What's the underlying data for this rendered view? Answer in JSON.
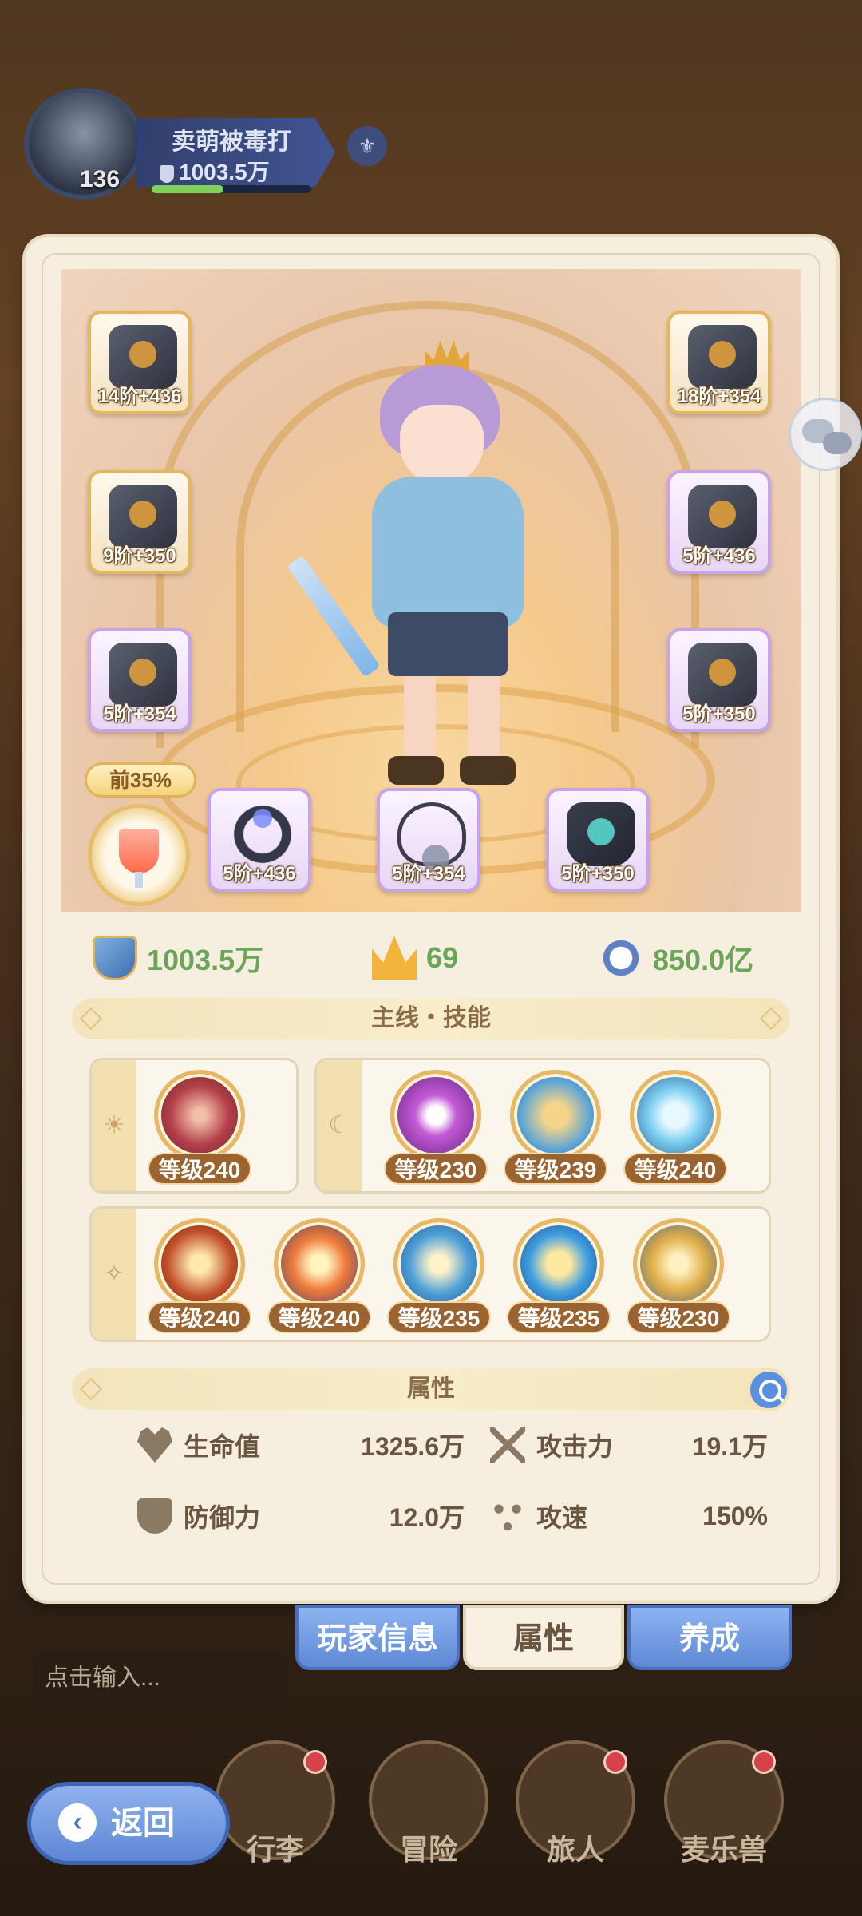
{
  "player": {
    "name": "卖萌被毒打",
    "power": "1003.5万",
    "level": "136"
  },
  "equipment": {
    "slots": [
      {
        "label": "14阶+436",
        "type": "weapon",
        "quality": "gold"
      },
      {
        "label": "18阶+354",
        "type": "helmet",
        "quality": "gold"
      },
      {
        "label": "9阶+350",
        "type": "armor",
        "quality": "gold"
      },
      {
        "label": "5阶+436",
        "type": "gauntlet",
        "quality": "purple"
      },
      {
        "label": "5阶+354",
        "type": "belt",
        "quality": "purple"
      },
      {
        "label": "5阶+350",
        "type": "boots",
        "quality": "purple"
      },
      {
        "label": "5阶+436",
        "type": "ring",
        "quality": "purple"
      },
      {
        "label": "5阶+354",
        "type": "necklace",
        "quality": "purple"
      },
      {
        "label": "5阶+350",
        "type": "bottle",
        "quality": "purple"
      }
    ],
    "drink_badge": "前35%"
  },
  "stats": {
    "power": "1003.5万",
    "crown": "69",
    "speed": "850.0亿"
  },
  "skills": {
    "header": "主线・技能",
    "group1": [
      "等级240"
    ],
    "group2": [
      "等级230",
      "等级239",
      "等级240"
    ],
    "group3": [
      "等级240",
      "等级240",
      "等级235",
      "等级235",
      "等级230"
    ]
  },
  "attributes": {
    "header": "属性",
    "hp_label": "生命值",
    "hp_value": "1325.6万",
    "atk_label": "攻击力",
    "atk_value": "19.1万",
    "def_label": "防御力",
    "def_value": "12.0万",
    "spd_label": "攻速",
    "spd_value": "150%"
  },
  "tabs": {
    "player_info": "玩家信息",
    "attributes": "属性",
    "training": "养成"
  },
  "chat": {
    "placeholder": "点击输入..."
  },
  "nav": {
    "back": "返回",
    "luggage": "行李",
    "adventure": "冒险",
    "traveler": "旅人",
    "pet": "麦乐兽"
  },
  "colors": {
    "accent_blue": "#5f88d6",
    "stat_green": "#6aa55a",
    "level_brown": "#9a6330"
  }
}
